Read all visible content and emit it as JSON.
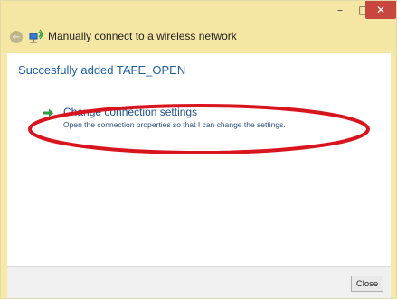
{
  "window": {
    "title": "Manually connect to a wireless network",
    "controls": {
      "minimize": "–",
      "maximize": "□",
      "close": "✕"
    }
  },
  "content": {
    "heading": "Succesfully added TAFE_OPEN",
    "option": {
      "title": "Change connection settings",
      "description": "Open the connection properties so that I can change the settings."
    }
  },
  "footer": {
    "close_label": "Close"
  },
  "colors": {
    "accent": "#1e5fa8",
    "highlight_ellipse": "#d8141c",
    "arrow": "#2e9e3f"
  },
  "icons": [
    "back-arrow-icon",
    "network-icon",
    "green-arrow-icon"
  ]
}
